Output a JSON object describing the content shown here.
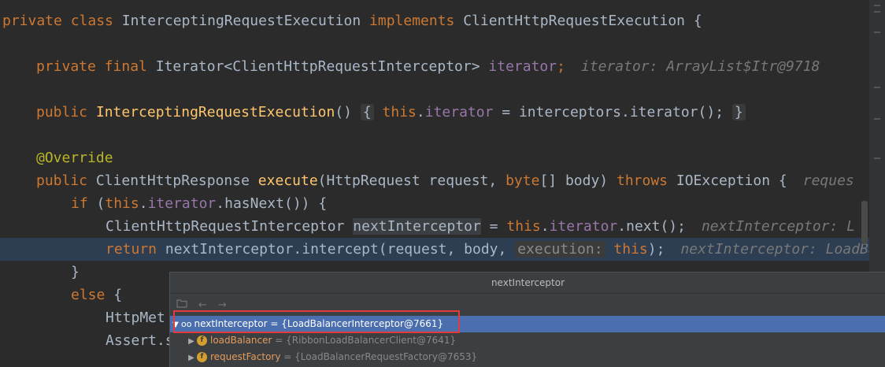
{
  "code": {
    "l1": {
      "k1": "private",
      "k2": "class",
      "name": "InterceptingRequestExecution",
      "k3": "implements",
      "iface": "ClientHttpRequestExecution",
      "brace": "{"
    },
    "l2": {
      "k1": "private",
      "k2": "final",
      "type": "Iterator<ClientHttpRequestInterceptor>",
      "field": "iterator",
      "semi": ";",
      "hint": "iterator: ArrayList$Itr@9718"
    },
    "l3": {
      "k1": "public",
      "ctor": "InterceptingRequestExecution",
      "parens": "()",
      "fold_open": "{",
      "this": "this",
      "field": "iterator",
      "rest": " = interceptors.iterator();",
      "fold_close": "}"
    },
    "l4": {
      "annotation": "@Override"
    },
    "l5": {
      "k1": "public",
      "type": "ClientHttpResponse",
      "method": "execute",
      "p1": "(HttpRequest request, ",
      "byte": "byte",
      "p2": "[] body) ",
      "throws": "throws",
      "p3": " IOException {",
      "hint": "reques"
    },
    "l6": {
      "k1": "if",
      "p1": " (",
      "this": "this",
      "p2": ".",
      "field": "iterator",
      "p3": ".hasNext()) {"
    },
    "l7": {
      "type": "ClientHttpRequestInterceptor",
      "var": "nextInterceptor",
      "p1": " = ",
      "this": "this",
      "p2": ".",
      "field": "iterator",
      "p3": ".next();",
      "hint": "nextInterceptor: L"
    },
    "l8": {
      "k1": "return",
      "p1": " nextInterceptor.intercept(request, body, ",
      "param_hint": "execution:",
      "this": "this",
      "p2": ");",
      "hint": "nextInterceptor: LoadBa"
    },
    "l9": {
      "brace": "}"
    },
    "l10": {
      "k1": "else",
      "p1": " {"
    },
    "l11": {
      "text": "HttpMet"
    },
    "l12": {
      "text": "Assert.s"
    }
  },
  "debug_popup": {
    "title": "nextInterceptor",
    "toolbar": {
      "back": "←",
      "forward": "→"
    },
    "rows": [
      {
        "name": "nextInterceptor",
        "value": "= {LoadBalancerInterceptor@7661}"
      },
      {
        "name": "loadBalancer",
        "value": "= {RibbonLoadBalancerClient@7641}"
      },
      {
        "name": "requestFactory",
        "value": "= {LoadBalancerRequestFactory@7653}"
      }
    ],
    "field_badge": "f"
  },
  "colors": {
    "keyword": "#cc7832",
    "method": "#ffc66d",
    "field": "#9876aa",
    "annotation": "#bbb529",
    "selection": "#4b6eaf",
    "highlight_box": "#e23b3b"
  }
}
